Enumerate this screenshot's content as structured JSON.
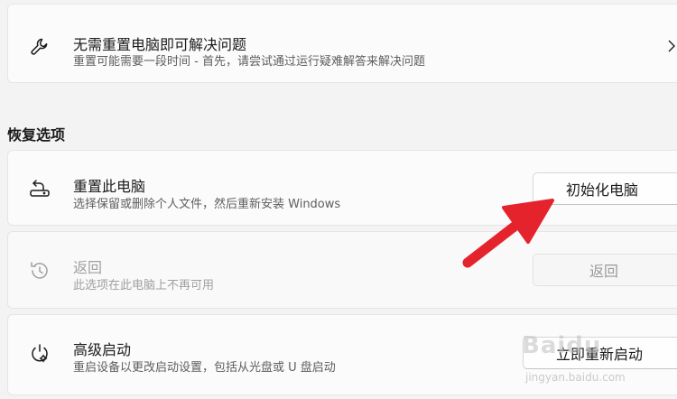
{
  "troubleshoot": {
    "title": "无需重置电脑即可解决问题",
    "description": "重置可能需要一段时间 - 首先，请尝试通过运行疑难解答来解决问题",
    "icon": "wrench-icon"
  },
  "section_heading": "恢复选项",
  "options": [
    {
      "title": "重置此电脑",
      "description": "选择保留或删除个人文件，然后重新安装 Windows",
      "button": "初始化电脑",
      "icon": "reset-pc-icon",
      "enabled": true
    },
    {
      "title": "返回",
      "description": "此选项在此电脑上不再可用",
      "button": "返回",
      "icon": "history-icon",
      "enabled": false
    },
    {
      "title": "高级启动",
      "description": "重启设备以更改启动设置，包括从光盘或 U 盘启动",
      "button": "立即重新启动",
      "icon": "advanced-startup-icon",
      "enabled": true
    }
  ],
  "annotation": {
    "arrow_color": "#e5232d"
  },
  "watermark": {
    "text": "Baidu",
    "sub": "jingyan.baidu.com"
  }
}
